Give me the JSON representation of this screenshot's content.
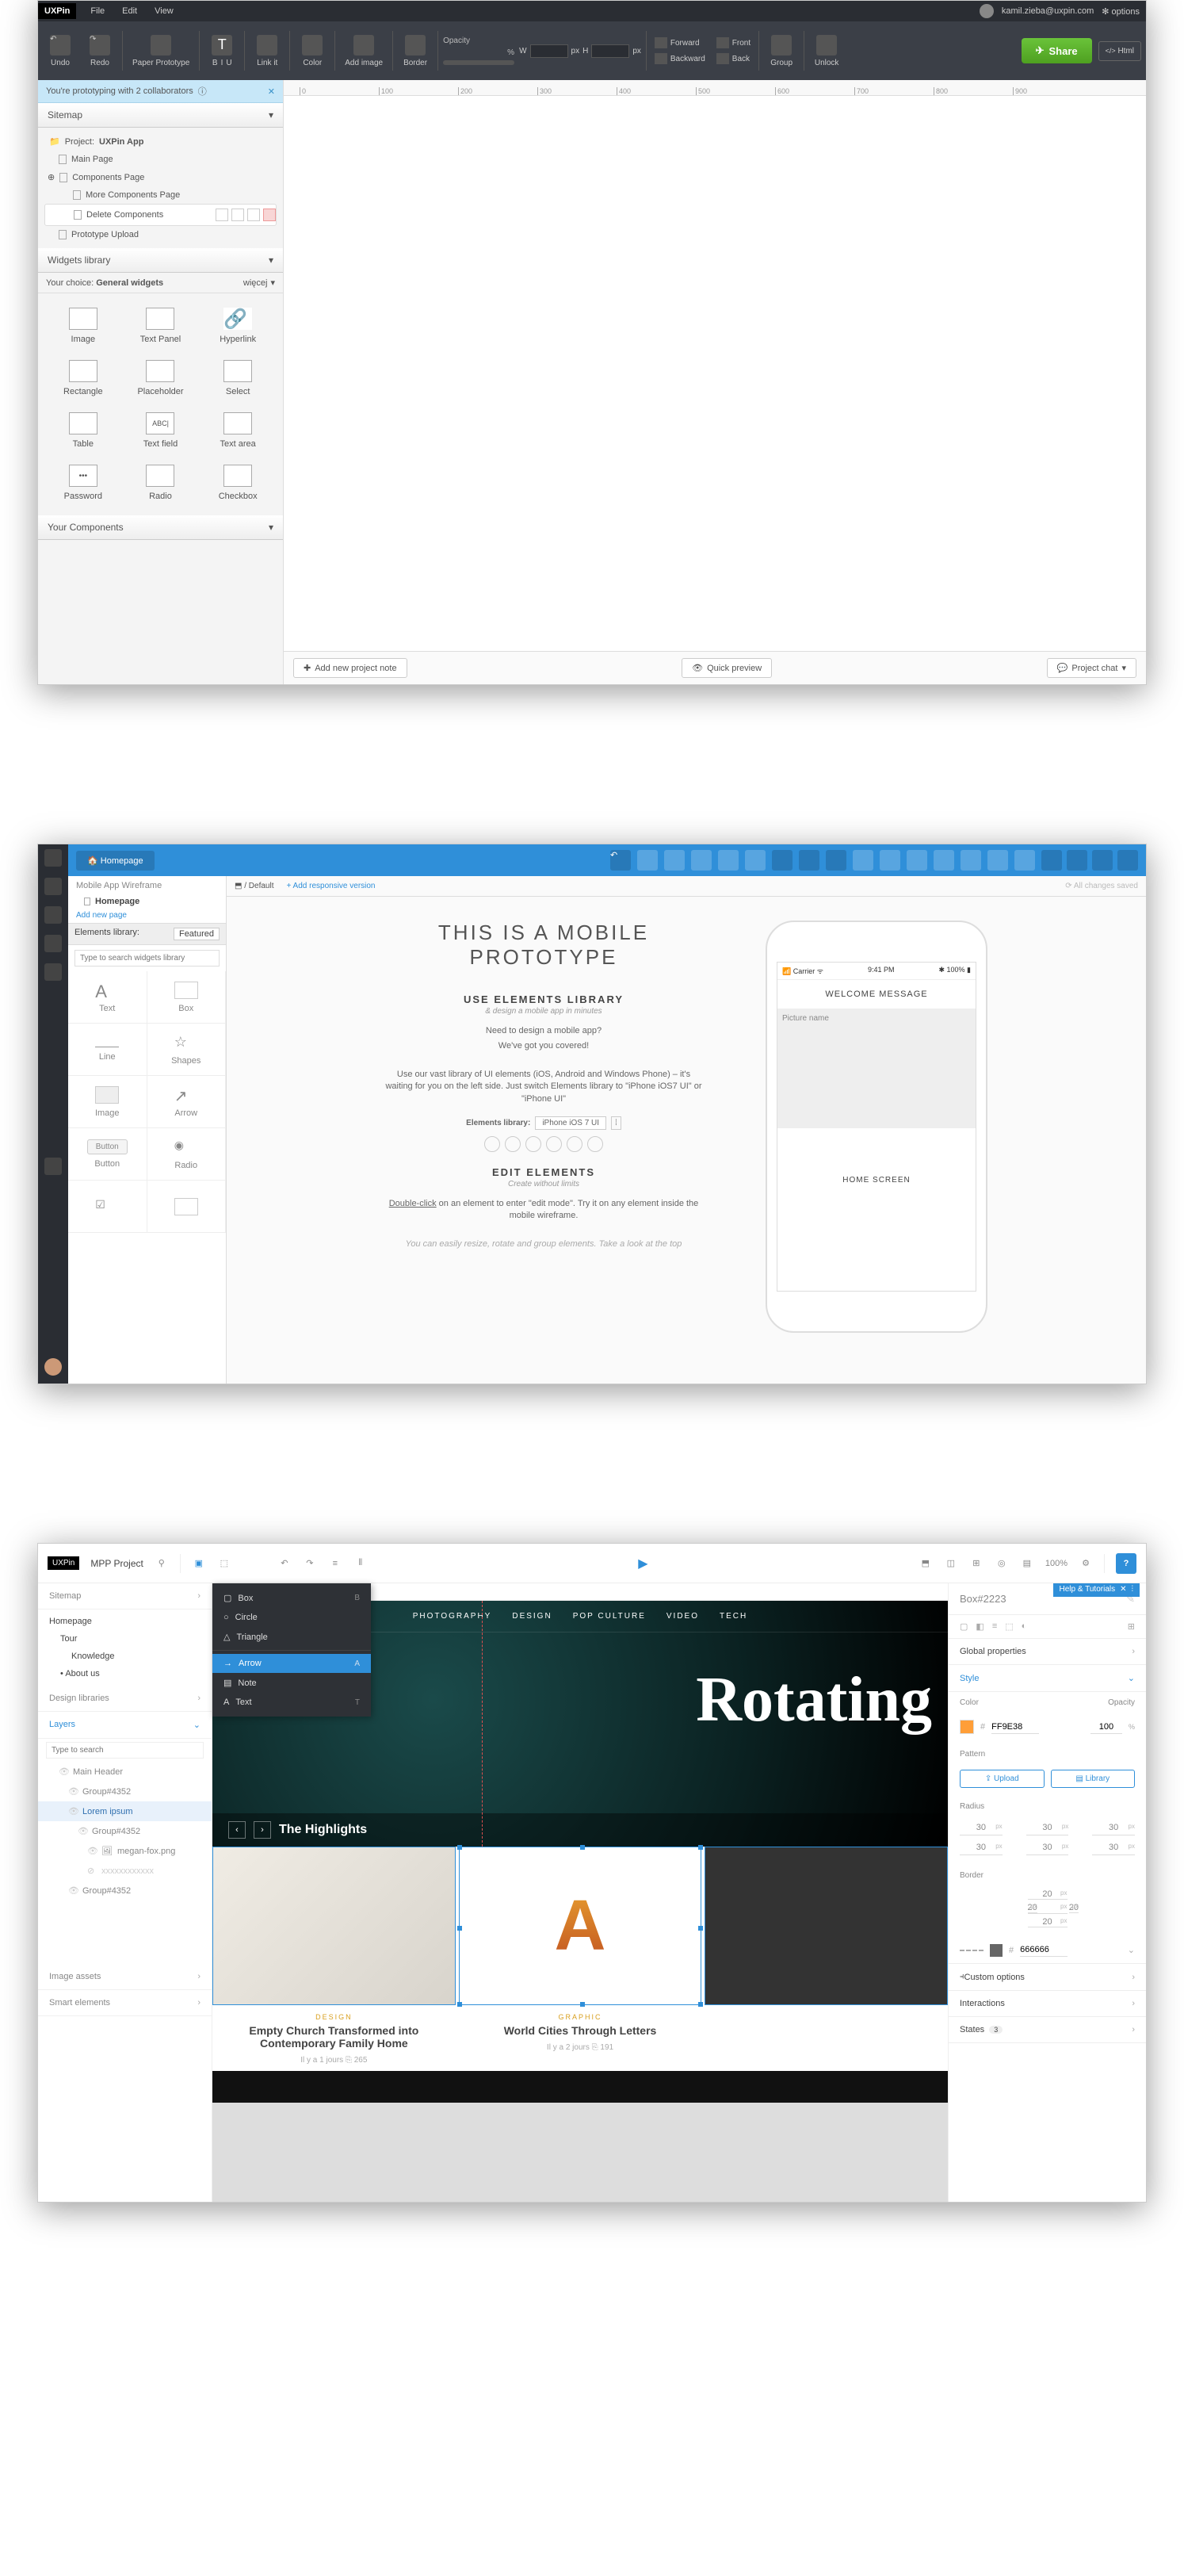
{
  "app1": {
    "menubar": {
      "logo": "UXPin",
      "items": [
        "File",
        "Edit",
        "View"
      ],
      "user": "kamil.zieba@uxpin.com",
      "options": "options"
    },
    "toolbar": {
      "undo": "Undo",
      "redo": "Redo",
      "paper": "Paper Prototype",
      "text": "T",
      "bold": "B",
      "italic": "I",
      "underline": "U",
      "link": "Link it",
      "color": "Color",
      "addimg": "Add image",
      "border": "Border",
      "opacity": "Opacity",
      "wlabel": "W",
      "hlabel": "H",
      "px": "px",
      "forward": "Forward",
      "backward": "Backward",
      "front": "Front",
      "back": "Back",
      "group": "Group",
      "unlock": "Unlock",
      "share": "Share",
      "html": "Html"
    },
    "banner": {
      "text": "You're prototyping with 2 collaborators",
      "close": "✕"
    },
    "sitemap": {
      "title": "Sitemap",
      "project_label": "Project:",
      "project_name": "UXPin App",
      "pages": [
        "Main Page",
        "Components Page",
        "More Components Page",
        "Delete Components",
        "Prototype Upload"
      ]
    },
    "widgets": {
      "title": "Widgets library",
      "choice_label": "Your choice:",
      "choice_value": "General widgets",
      "more": "więcej",
      "items": [
        "Image",
        "Text Panel",
        "Hyperlink",
        "Rectangle",
        "Placeholder",
        "Select",
        "Table",
        "Text field",
        "Text area",
        "Password",
        "Radio",
        "Checkbox"
      ]
    },
    "components": {
      "title": "Your Components"
    },
    "footer": {
      "addnote": "Add new project note",
      "preview": "Quick preview",
      "chat": "Project chat"
    },
    "ruler": [
      "0",
      "100",
      "200",
      "300",
      "400",
      "500",
      "600",
      "700",
      "800",
      "900"
    ]
  },
  "app2": {
    "crumb": "Homepage",
    "side": {
      "title": "Mobile App Wireframe",
      "page": "Homepage",
      "addnew": "Add new page",
      "lib_label": "Elements library:",
      "lib_value": "Featured",
      "search_ph": "Type to search widgets library",
      "widgets": [
        "Text",
        "Box",
        "Line",
        "Shapes",
        "Image",
        "Arrow",
        "Button",
        "Radio"
      ],
      "button_label": "Button"
    },
    "tabs": {
      "default": "Default",
      "add": "+ Add responsive version",
      "saved": "All changes saved"
    },
    "doc": {
      "h1": "THIS IS A MOBILE  PROTOTYPE",
      "h2a": "USE ELEMENTS LIBRARY",
      "h2a_sub": "& design a mobile app in minutes",
      "p1": "Need to design a mobile app?",
      "p2": "We've got you covered!",
      "p3": "Use our vast library of UI elements (iOS, Android and Windows Phone) – it's waiting for you on the left side. Just switch Elements library to \"iPhone iOS7 UI\" or \"iPhone UI\"",
      "chip_label": "Elements library:",
      "chip_value": "iPhone iOS 7 UI",
      "h2b": "EDIT ELEMENTS",
      "h2b_sub": "Create without limits",
      "p4a": "Double-click",
      "p4b": " on an element to enter \"edit mode\". Try it on any element inside the mobile wireframe.",
      "p5": "You can easily resize, rotate and group elements. Take a look at the top"
    },
    "phone": {
      "carrier": "Carrier",
      "time": "9:41 PM",
      "batt": "100%",
      "welcome": "WELCOME MESSAGE",
      "pic": "Picture name",
      "home": "HOME SCREEN"
    }
  },
  "app3": {
    "top": {
      "logo": "UXPin",
      "project": "MPP Project",
      "zoom": "100%",
      "help": "?"
    },
    "helpbar": {
      "label": "Help & Tutorials"
    },
    "sitemap": {
      "title": "Sitemap",
      "items": [
        "Homepage",
        "Tour",
        "Knowledge",
        "About us"
      ]
    },
    "shapes": {
      "items": [
        "Box",
        "Circle",
        "Triangle",
        "Arrow",
        "Note",
        "Text"
      ],
      "keys": [
        "B",
        "",
        "",
        "A",
        "",
        "T"
      ],
      "active_index": 3
    },
    "design": {
      "title": "Design libraries"
    },
    "layers": {
      "title": "Layers",
      "search_ph": "Type to search",
      "items": [
        "Main Header",
        "Group#4352",
        "Lorem ipsum",
        "Group#4352",
        "megan-fox.png",
        "xxxxxxxxxxxx",
        "Group#4352"
      ]
    },
    "imgassets": "Image assets",
    "smart": "Smart elements",
    "nav": [
      "PHOTOGRAPHY",
      "DESIGN",
      "POP CULTURE",
      "VIDEO",
      "TECH"
    ],
    "hero_title": "Rotating",
    "highlights": "The Highlights",
    "cards": [
      {
        "tag": "DESIGN",
        "title": "Empty Church Transformed into Contemporary Family Home",
        "meta": "Il y a 1 jours   ⎘ 265"
      },
      {
        "tag": "GRAPHIC",
        "title": "World Cities Through Letters",
        "meta": "Il y a 2 jours   ⎘ 191"
      }
    ],
    "props": {
      "name": "Box#2223",
      "global": "Global properties",
      "style": "Style",
      "color_label": "Color",
      "opacity_label": "Opacity",
      "color_hex": "FF9E38",
      "opacity_val": "100",
      "pattern": "Pattern",
      "upload": "Upload",
      "library": "Library",
      "radius": "Radius",
      "radius_vals": [
        "30",
        "30",
        "30",
        "30",
        "30",
        "30"
      ],
      "border": "Border",
      "border_vals": [
        "20",
        "20",
        "20",
        "20"
      ],
      "border_hex": "666666",
      "custom": "Custom options",
      "interactions": "Interactions",
      "states": "States",
      "states_n": "3"
    }
  }
}
